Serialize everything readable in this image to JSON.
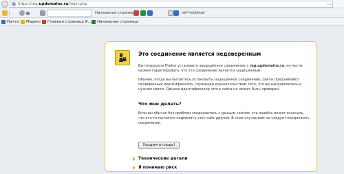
{
  "browser": {
    "url_prefix": "https://reg.",
    "url_domain": "updomains.ru",
    "url_suffix": "/login.php",
    "url_right": "☆ ▾"
  },
  "toolbar": {
    "search_value": "",
    "home_label": "Начальная страница",
    "rel_text": "rel='nofollow'"
  },
  "bookmarks": [
    {
      "label": "Почта",
      "color": "#3b6fb6"
    },
    {
      "label": "Маркет",
      "color": "#e6b800"
    },
    {
      "label": "Главная страница Я...",
      "color": "#d63b2a"
    },
    {
      "label": "Начальная страница",
      "color": "#2f7d2f"
    }
  ],
  "error": {
    "title": "Это соединение является недоверенным",
    "para1_a": "Вы попросили Firefox установить защищённое соединение с ",
    "para1_host": "reg.updomains.ru",
    "para1_b": ", но мы не можем гарантировать, что это соединение является защищённым.",
    "para2": "Обычно, когда вы пытаетесь установить защищённое соединение, сайты предъявляют проверенный идентификатор, служащий доказательством того, что вы направляетесь в нужное место. Однако идентификатор этого сайта не может быть проверен.",
    "subtitle": "Что мне делать?",
    "para3": "Если вы обычно без проблем соединяетесь с данным сайтом, эта ошибка может означать, что кто-то пытается подменить этот сайт другим. В этом случае вам не следует продолжать соединение.",
    "button_label": "Уходим отсюда!",
    "expander1": "Технические детали",
    "expander2": "Я понимаю риск"
  }
}
